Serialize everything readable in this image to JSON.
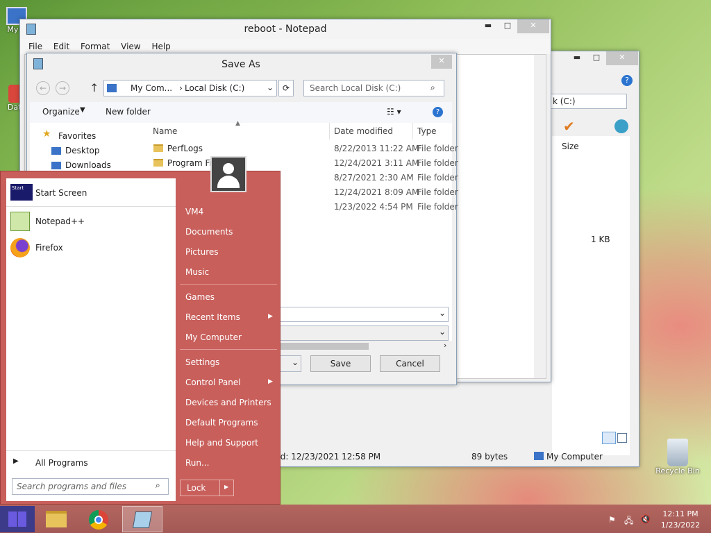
{
  "desktop": {
    "icons": [
      {
        "label": "My C"
      },
      {
        "label": "Data"
      }
    ],
    "recycle_bin": "Recycle Bin"
  },
  "notepad": {
    "title": "reboot - Notepad",
    "menu": [
      "File",
      "Edit",
      "Format",
      "View",
      "Help"
    ],
    "minimize": "▬",
    "maximize": "□",
    "close": "✕"
  },
  "explorer_back": {
    "address": "k (C:)",
    "col_size": "Size",
    "size_value": "1 KB",
    "status_modified": "ied: 12/23/2021 12:58 PM",
    "status_size": "89 bytes",
    "status_location": "My Computer",
    "minimize": "▬",
    "maximize": "□",
    "close": "✕"
  },
  "save_as": {
    "title": "Save As",
    "close": "✕",
    "breadcrumb": [
      "My Com...",
      "Local Disk (C:)"
    ],
    "search_placeholder": "Search Local Disk (C:)",
    "organize": "Organize",
    "new_folder": "New folder",
    "columns": {
      "name": "Name",
      "date": "Date modified",
      "type": "Type"
    },
    "nav": [
      "Favorites",
      "Desktop",
      "Downloads"
    ],
    "files": [
      {
        "name": "PerfLogs",
        "date": "8/22/2013 11:22 AM",
        "type": "File folder"
      },
      {
        "name": "Program Fil",
        "date": "12/24/2021 3:11 AM",
        "type": "File folder"
      },
      {
        "name": "",
        "date": "8/27/2021 2:30 AM",
        "type": "File folder"
      },
      {
        "name": "",
        "date": "12/24/2021 8:09 AM",
        "type": "File folder"
      },
      {
        "name": "",
        "date": "1/23/2022 4:54 PM",
        "type": "File folder"
      }
    ],
    "save": "Save",
    "cancel": "Cancel"
  },
  "start_menu": {
    "pinned": [
      {
        "label": "Start Screen"
      },
      {
        "label": "Notepad++"
      },
      {
        "label": "Firefox"
      }
    ],
    "all_programs": "All Programs",
    "search_placeholder": "Search programs and files",
    "right_items": [
      "VM4",
      "Documents",
      "Pictures",
      "Music",
      "Games",
      "Recent Items",
      "My Computer",
      "Settings",
      "Control Panel",
      "Devices and Printers",
      "Default Programs",
      "Help and Support",
      "Run..."
    ],
    "lock": "Lock"
  },
  "taskbar": {
    "time": "12:11 PM",
    "date": "1/23/2022"
  }
}
